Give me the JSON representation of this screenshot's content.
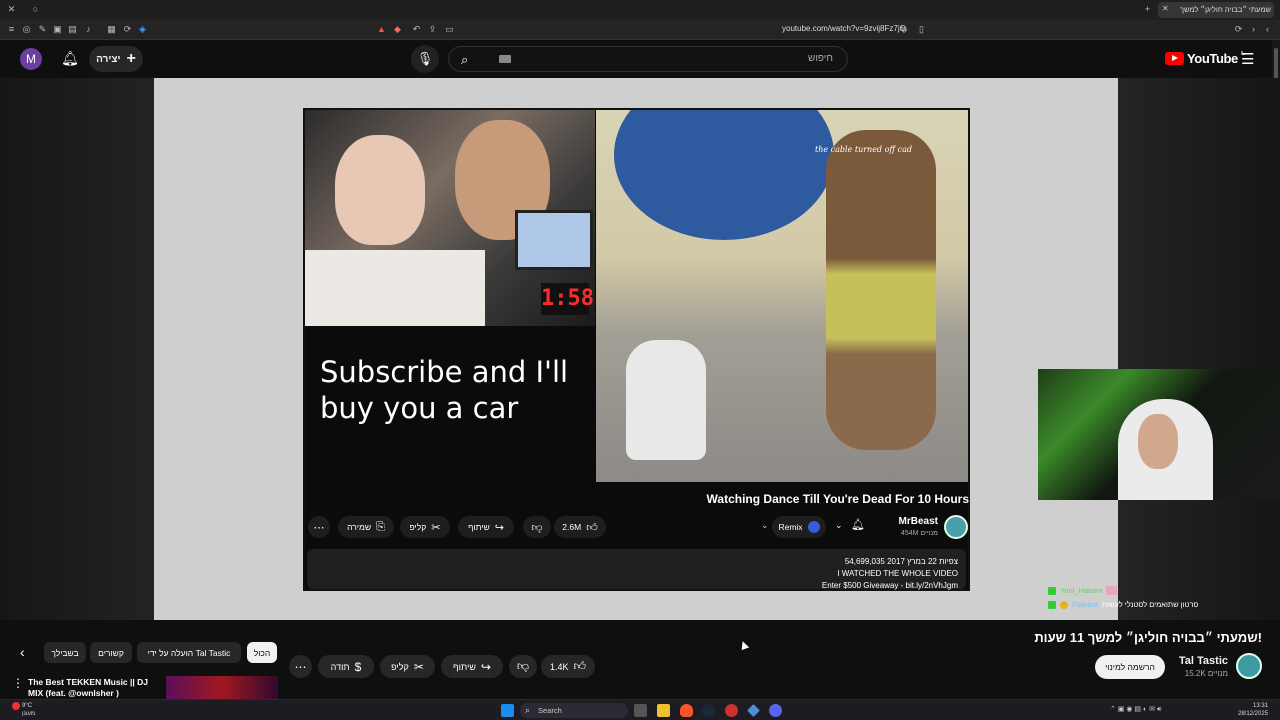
{
  "browser": {
    "url": "youtube.com/watch?v=9zvij8Fz7jQ",
    "tab_title": "שמעתי ״בבויה חוליגן״ למשך"
  },
  "header": {
    "avatar_letter": "M",
    "create_label": "יצירה",
    "search_placeholder": "חיפוש",
    "logo_text": "YouTube",
    "logo_super": "IL"
  },
  "player": {
    "overlay_text": "Subscribe and I'll buy you a car",
    "timer_text": "1:58",
    "dance_caption": "the cable turned off cad",
    "video_title": "Watching Dance Till You're Dead For 10 Hours",
    "channel_name": "MrBeast",
    "channel_subs": "454M מנויים",
    "remix_label": "Remix",
    "like_count": "2.6M",
    "share_label": "שיתוף",
    "clip_label": "קליפ",
    "save_label": "שמירה",
    "desc_stats": "54,699,035 צפיות  22 במרץ 2017",
    "desc_line1": "I WATCHED THE WHOLE VIDEO",
    "desc_line2": "Enter $500 Giveaway - bit.ly/2nVhJgm"
  },
  "chat": [
    {
      "user": "Yoni_Hataim",
      "text": ""
    },
    {
      "user": "Flakitsa",
      "text": "סרטון שתואמים לסטנלי לעשות"
    }
  ],
  "page": {
    "title": "שמעתי ״בבויה חוליגן״ למשך 11 שעות!",
    "channel_name": "Tal Tastic",
    "channel_subs": "15.2K מנויים",
    "subscribe_label": "הרשמה למינוי",
    "like_count": "1.4K",
    "share_label": "שיתוף",
    "clip_label": "קליפ",
    "thanks_label": "תודה",
    "chips": [
      "הכול",
      "הועלה על ידי Tal Tastic",
      "קשורים",
      "בשבילך"
    ],
    "related_title": "The Best TEKKEN Music || DJ MIX (feat. @ownlsher )"
  },
  "taskbar": {
    "search_label": "Search",
    "weather_temp": "9°C",
    "weather_desc": "מעונן",
    "time": "13:31",
    "date": "28/12/2025"
  },
  "colors": {
    "yt_red": "#ff0000",
    "bg": "#0f0f0f",
    "pill": "#272727"
  }
}
